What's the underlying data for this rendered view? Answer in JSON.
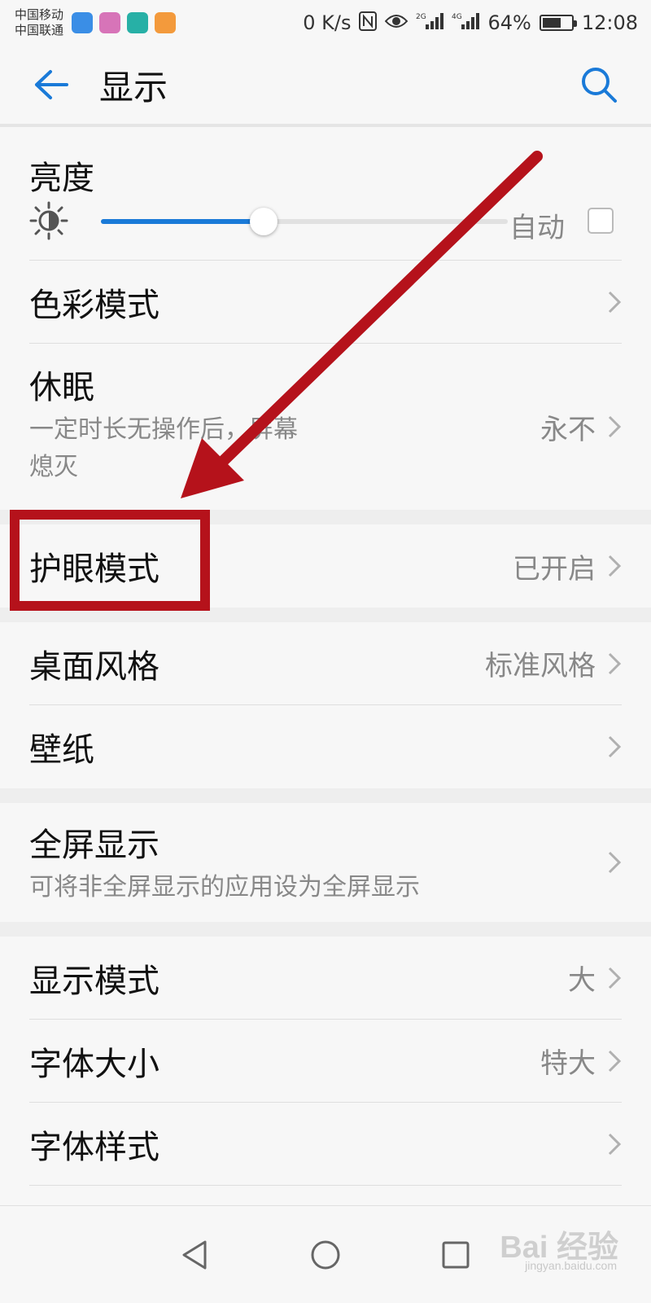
{
  "status_bar": {
    "carrier_1": "中国移动",
    "carrier_2": "中国联通",
    "net_speed": "0 K/s",
    "network_2g": "2G",
    "network_4g": "4G",
    "battery_text": "64%",
    "battery_level": 0.64,
    "time": "12:08",
    "icons": [
      "shield-app-icon",
      "contacts-app-icon",
      "browser-app-icon",
      "video-app-icon",
      "nfc-icon",
      "eye-icon",
      "signal-icon",
      "battery-icon"
    ]
  },
  "header": {
    "title": "显示",
    "back_icon": "arrow-left-icon",
    "search_icon": "search-icon",
    "accent_color": "#1a7ad8"
  },
  "brightness": {
    "title": "亮度",
    "auto_label": "自动",
    "level": 0.4,
    "auto_checked": false
  },
  "rows": {
    "color_mode": {
      "title": "色彩模式",
      "value": ""
    },
    "sleep": {
      "title": "休眠",
      "subtitle_line1": "一定时长无操作后，屏幕",
      "subtitle_line2": "熄灭",
      "value": "永不"
    },
    "eye_comfort": {
      "title": "护眼模式",
      "value": "已开启"
    },
    "desktop_style": {
      "title": "桌面风格",
      "value": "标准风格"
    },
    "wallpaper": {
      "title": "壁纸",
      "value": ""
    },
    "full_screen": {
      "title": "全屏显示",
      "subtitle": "可将非全屏显示的应用设为全屏显示"
    },
    "display_mode": {
      "title": "显示模式",
      "value": "大"
    },
    "font_size": {
      "title": "字体大小",
      "value": "特大"
    },
    "font_style": {
      "title": "字体样式",
      "value": ""
    }
  },
  "annotation": {
    "color": "#b5121b"
  },
  "watermark": {
    "text": "Bai 经验",
    "sub": "jingyan.baidu.com"
  }
}
